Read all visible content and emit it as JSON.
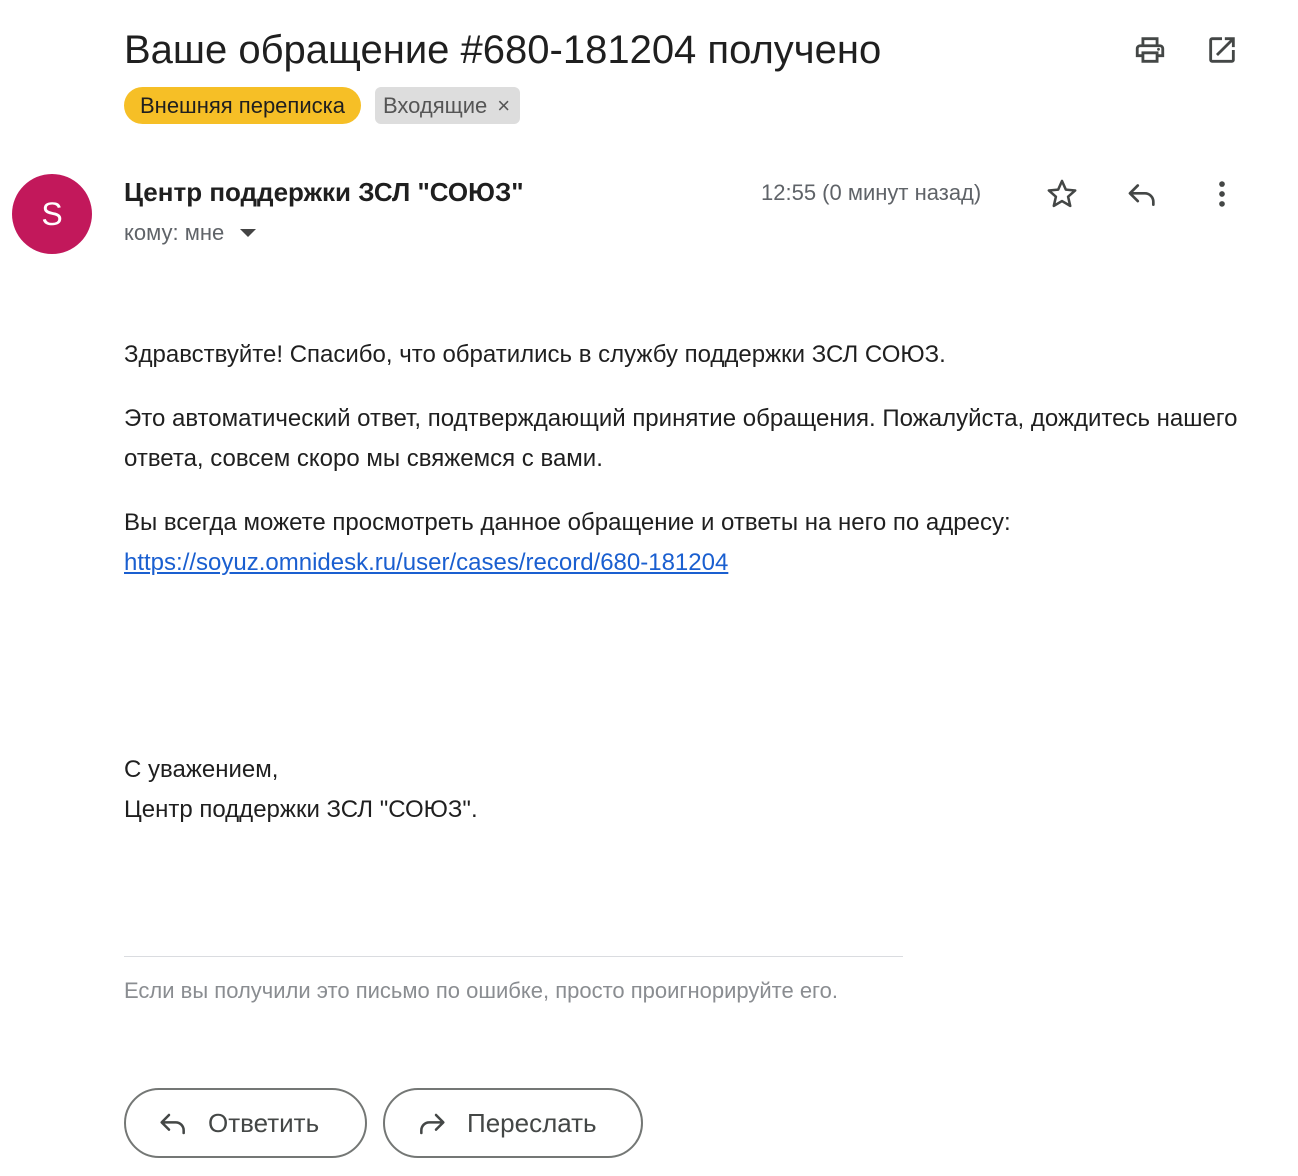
{
  "email": {
    "subject": "Ваше обращение #680-181204 получено",
    "labels": [
      {
        "text": "Внешняя переписка",
        "color": "#f6bf26"
      },
      {
        "text": "Входящие",
        "removable": true,
        "remove_glyph": "×"
      }
    ],
    "sender": {
      "avatar_letter": "S",
      "avatar_color": "#c2185b",
      "name": "Центр поддержки ЗСЛ \"СОЮЗ\"",
      "recipient": "кому: мне"
    },
    "time": "12:55 (0 минут назад)",
    "body": {
      "greeting": "Здравствуйте! Спасибо, что обратились в службу поддержки ЗСЛ СОЮЗ.",
      "auto_reply": "Это автоматический ответ, подтверждающий принятие обращения. Пожалуйста, дождитесь нашего ответа, совсем скоро мы свяжемся с вами.",
      "view_note": "Вы всегда можете просмотреть данное обращение и ответы на него по адресу:",
      "link": "https://soyuz.omnidesk.ru/user/cases/record/680-181204",
      "closing": "С уважением,",
      "signature": "Центр поддержки ЗСЛ \"СОЮЗ\"."
    },
    "footer_note": "Если вы получили это письмо по ошибке, просто проигнорируйте его."
  },
  "actions": {
    "reply_label": "Ответить",
    "forward_label": "Переслать"
  },
  "icons": {
    "print": "print-icon",
    "open_new_window": "open-in-new-window-icon",
    "star": "star-icon",
    "reply": "reply-icon",
    "more": "more-vertical-icon",
    "dropdown": "chevron-down-icon",
    "forward": "forward-icon"
  },
  "colors": {
    "link": "#1a5fd0",
    "label_yellow": "#f6bf26",
    "label_grey": "#dddddd"
  }
}
